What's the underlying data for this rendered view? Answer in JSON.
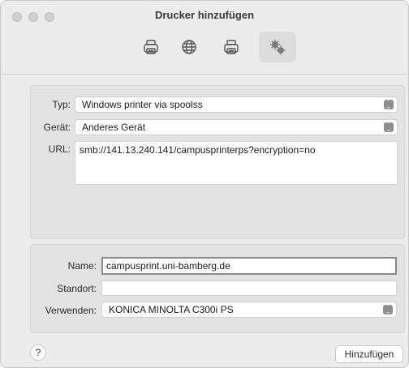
{
  "window": {
    "title": "Drucker hinzufügen"
  },
  "toolbar": {
    "items": [
      {
        "name": "default",
        "icon": "printer-icon"
      },
      {
        "name": "ip",
        "icon": "globe-icon"
      },
      {
        "name": "windows",
        "icon": "printer-icon"
      },
      {
        "name": "advanced",
        "icon": "gears-icon",
        "selected": true
      }
    ]
  },
  "connection": {
    "type_label": "Typ:",
    "type_value": "Windows printer via spoolss",
    "device_label": "Gerät:",
    "device_value": "Anderes Gerät",
    "url_label": "URL:",
    "url_value": "smb://141.13.240.141/campusprinterps?encryption=no"
  },
  "details": {
    "name_label": "Name:",
    "name_value": "campusprint.uni-bamberg.de",
    "location_label": "Standort:",
    "location_value": "",
    "use_label": "Verwenden:",
    "use_value": "KONICA MINOLTA C300i PS"
  },
  "footer": {
    "help_label": "?",
    "add_label": "Hinzufügen"
  }
}
